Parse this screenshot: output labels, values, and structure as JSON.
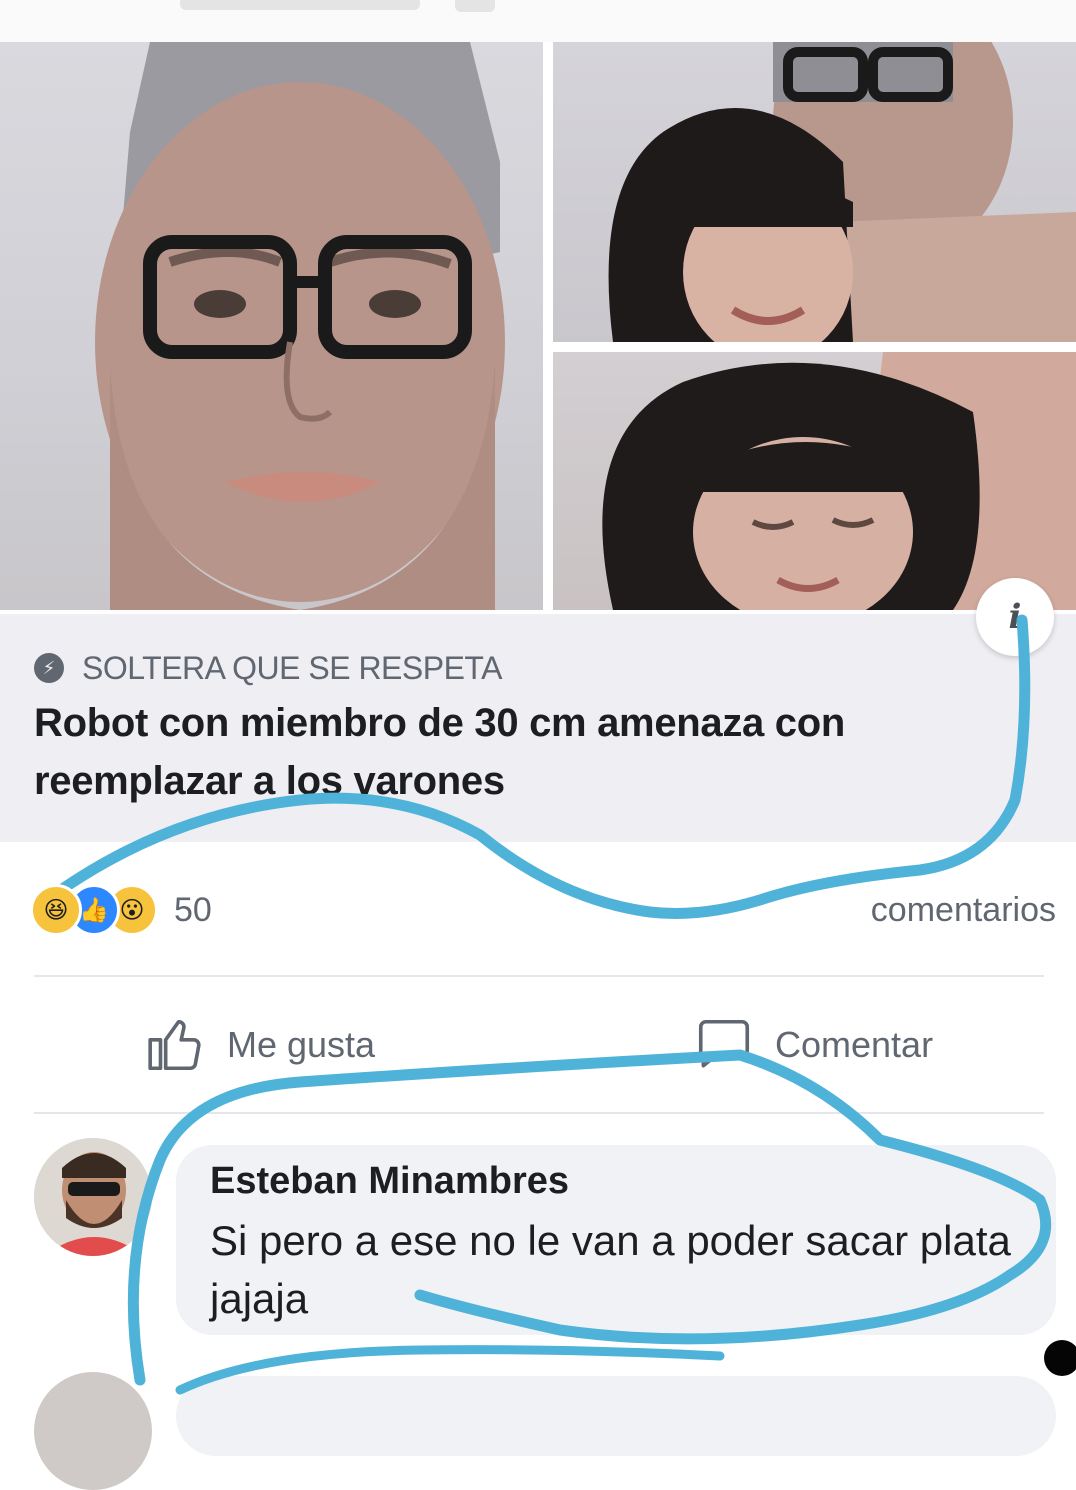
{
  "post": {
    "source_name": "SOLTERA QUE SE RESPETA",
    "headline": "Robot con miembro de 30 cm amenaza con reemplazar a los varones",
    "info_icon": "i"
  },
  "reactions": {
    "icons": [
      "haha-icon",
      "like-icon",
      "wow-icon"
    ],
    "count": "50",
    "comments_label": "comentarios"
  },
  "actions": {
    "like_label": "Me gusta",
    "comment_label": "Comentar"
  },
  "comment": {
    "author": "Esteban Minambres",
    "text": "Si pero a ese no le van a poder sacar plata jajaja"
  },
  "colors": {
    "scribble": "#4fb3d9",
    "caption_background": "#eeeef3",
    "muted_text": "#606770"
  }
}
